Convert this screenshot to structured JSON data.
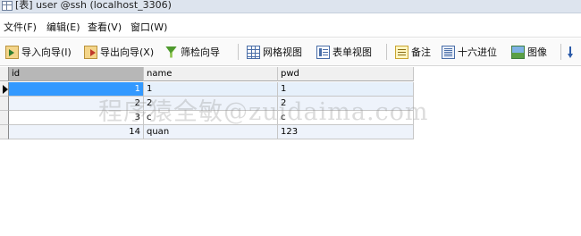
{
  "window": {
    "title": "[表] user @ssh (localhost_3306)"
  },
  "menu": [
    "文件(F)",
    "编辑(E)",
    "查看(V)",
    "窗口(W)"
  ],
  "toolbar": {
    "import": "导入向导(I)",
    "export": "导出向导(X)",
    "filter": "筛检向导",
    "grid_view": "网格视图",
    "form_view": "表单视图",
    "memo": "备注",
    "hex": "十六进位",
    "image": "图像"
  },
  "table": {
    "columns": [
      "id",
      "name",
      "pwd"
    ],
    "rows": [
      {
        "id": "1",
        "name": "1",
        "pwd": "1"
      },
      {
        "id": "2",
        "name": "2",
        "pwd": "2"
      },
      {
        "id": "3",
        "name": "c",
        "pwd": "c"
      },
      {
        "id": "14",
        "name": "quan",
        "pwd": "123"
      }
    ],
    "selected_row": 0
  },
  "watermark": "程序猿全敏@zuidaima.com",
  "colors": {
    "selection": "#3399ff",
    "header_sel": "#b7b7b7",
    "title_bar": "#dde4ee"
  }
}
